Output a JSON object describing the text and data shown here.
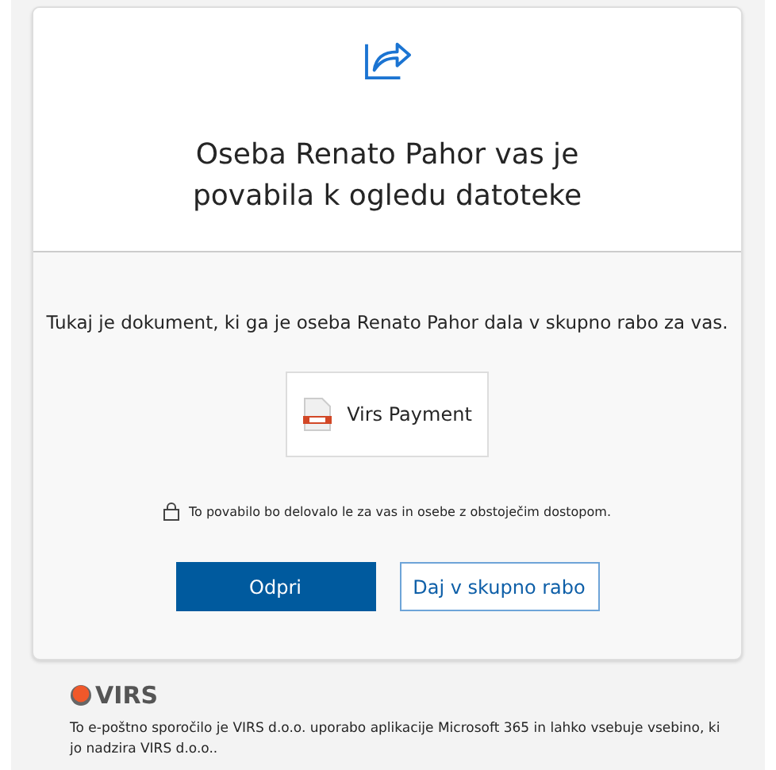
{
  "header": {
    "title": "Oseba Renato Pahor vas je povabila k ogledu datoteke"
  },
  "body": {
    "message": "Tukaj je dokument, ki ga je oseba Renato Pahor dala v skupno rabo za vas.",
    "file": {
      "name": "Virs Payment"
    },
    "notice": "To povabilo bo delovalo le za vas in osebe z obstoječim dostopom."
  },
  "buttons": [
    {
      "label": "Odpri",
      "kind": "primary"
    },
    {
      "label": "Daj v skupno rabo",
      "kind": "secondary"
    }
  ],
  "footer": {
    "logo": "VIRS",
    "text": "To e-poštno sporočilo je VIRS d.o.o. uporabo aplikacije Microsoft 365 in lahko vsebuje vsebino, ki jo nadzira VIRS d.o.o.."
  }
}
